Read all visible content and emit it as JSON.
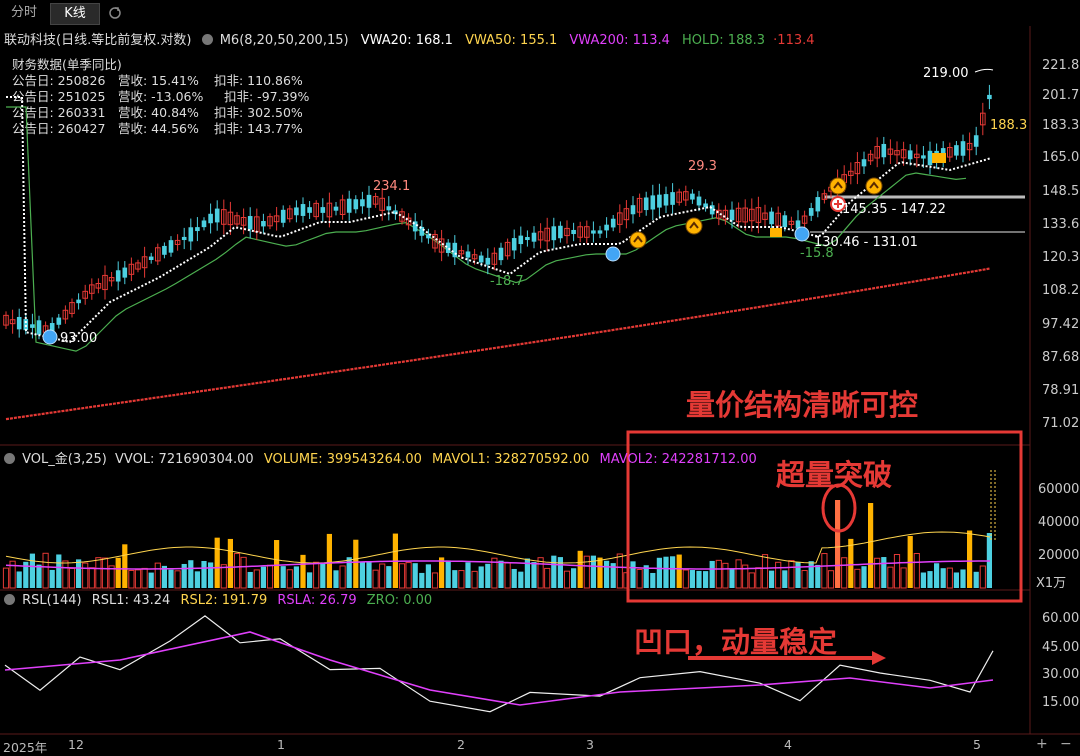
{
  "tabs": [
    {
      "label": "分时"
    },
    {
      "label": "K线"
    }
  ],
  "header": {
    "title": "联动科技(日线.等比前复权.对数)",
    "m6": "M6(8,20,50,200,15)",
    "vwa20": "VWA20: 168.1",
    "vwa50": "VWA50: 155.1",
    "vwa200": "VWA200: 113.4",
    "hold": "HOLD: 188.3",
    "hold_extra": "·113.4"
  },
  "financial": {
    "title": "财务数据(单季同比)",
    "rows": [
      {
        "date": "公告日: 250826",
        "rev": "营收: 15.41%",
        "profit": "扣非: 110.86%"
      },
      {
        "date": "公告日: 251025",
        "rev": "营收: -13.06%",
        "profit": "扣非: -97.39%"
      },
      {
        "date": "公告日: 260331",
        "rev": "营收: 40.84%",
        "profit": "扣非: 302.50%"
      },
      {
        "date": "公告日: 260427",
        "rev": "营收: 44.56%",
        "profit": "扣非: 143.77%"
      }
    ]
  },
  "price_axis": [
    "221.8",
    "201.7",
    "183.3",
    "165.0",
    "148.5",
    "133.6",
    "120.3",
    "108.2",
    "97.42",
    "87.68",
    "78.91",
    "71.02"
  ],
  "price_labels": {
    "high_219": "219.00",
    "hold_tag": "188.3",
    "p234": "234.1",
    "p293": "93.00",
    "p29": "29.3",
    "n187": "-18.7",
    "n158": "-15.8",
    "range1": "145.35 - 147.22",
    "range2": "130.46 - 131.01"
  },
  "annotations": {
    "a1": "量价结构清晰可控",
    "a2": "超量突破",
    "a3": "凹口，动量稳定"
  },
  "volume": {
    "header": "VOL_金(3,25)",
    "vvol": "VVOL: 721690304.00",
    "volume": "VOLUME: 399543264.00",
    "mavol1": "MAVOL1: 328270592.00",
    "mavol2": "MAVOL2: 242281712.00",
    "axis": [
      "60000",
      "40000",
      "20000"
    ],
    "unit": "X1万"
  },
  "rsl": {
    "header": "RSL(144)",
    "rsl1": "RSL1: 43.24",
    "rsl2": "RSL2: 191.79",
    "rsla": "RSLA: 26.79",
    "zro": "ZRO: 0.00",
    "axis": [
      "60.00",
      "45.00",
      "30.00",
      "15.00"
    ]
  },
  "xaxis": {
    "year": "2025年",
    "m12": "12",
    "m1": "1",
    "m2": "2",
    "m3": "3",
    "m4": "4",
    "m5": "5"
  },
  "colors": {
    "up": "#e53935",
    "down": "#4dd0e1",
    "gold": "#ffb300",
    "vwa20": "#ffffff",
    "vwa50": "#ffd54f",
    "vwa200": "#e040fb",
    "hold": "#4caf50",
    "red": "#e53935"
  }
}
